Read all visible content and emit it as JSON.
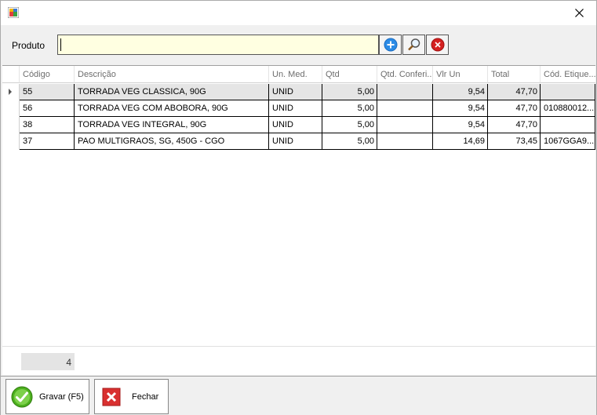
{
  "produto": {
    "label": "Produto",
    "value": "",
    "add_icon": "plus-circle-icon",
    "search_icon": "magnifier-icon",
    "clear_icon": "x-circle-icon"
  },
  "grid": {
    "columns": [
      "Código",
      "Descrição",
      "Un. Med.",
      "Qtd",
      "Qtd. Conferi...",
      "Vlr Un",
      "Total",
      "Cód. Etique..."
    ],
    "rows": [
      {
        "codigo": "55",
        "descricao": "TORRADA VEG CLASSICA, 90G",
        "un": "UNID",
        "qtd": "5,00",
        "qtd_conf": "",
        "vlr_un": "9,54",
        "total": "47,70",
        "etiqueta": ""
      },
      {
        "codigo": "56",
        "descricao": "TORRADA VEG COM ABOBORA, 90G",
        "un": "UNID",
        "qtd": "5,00",
        "qtd_conf": "",
        "vlr_un": "9,54",
        "total": "47,70",
        "etiqueta": "010880012..."
      },
      {
        "codigo": "38",
        "descricao": "TORRADA VEG INTEGRAL, 90G",
        "un": "UNID",
        "qtd": "5,00",
        "qtd_conf": "",
        "vlr_un": "9,54",
        "total": "47,70",
        "etiqueta": ""
      },
      {
        "codigo": "37",
        "descricao": "PAO MULTIGRAOS, SG, 450G - CGO",
        "un": "UNID",
        "qtd": "5,00",
        "qtd_conf": "",
        "vlr_un": "14,69",
        "total": "73,45",
        "etiqueta": "1067GGA9..."
      }
    ]
  },
  "footer": {
    "count": "4"
  },
  "buttons": {
    "save_label": "Gravar (F5)",
    "close_label": "Fechar"
  },
  "colors": {
    "input_bg": "#ffffe1",
    "add_blue": "#2b8be6",
    "clear_red": "#d42020",
    "save_green": "#4caf1e",
    "close_red": "#d93030"
  }
}
